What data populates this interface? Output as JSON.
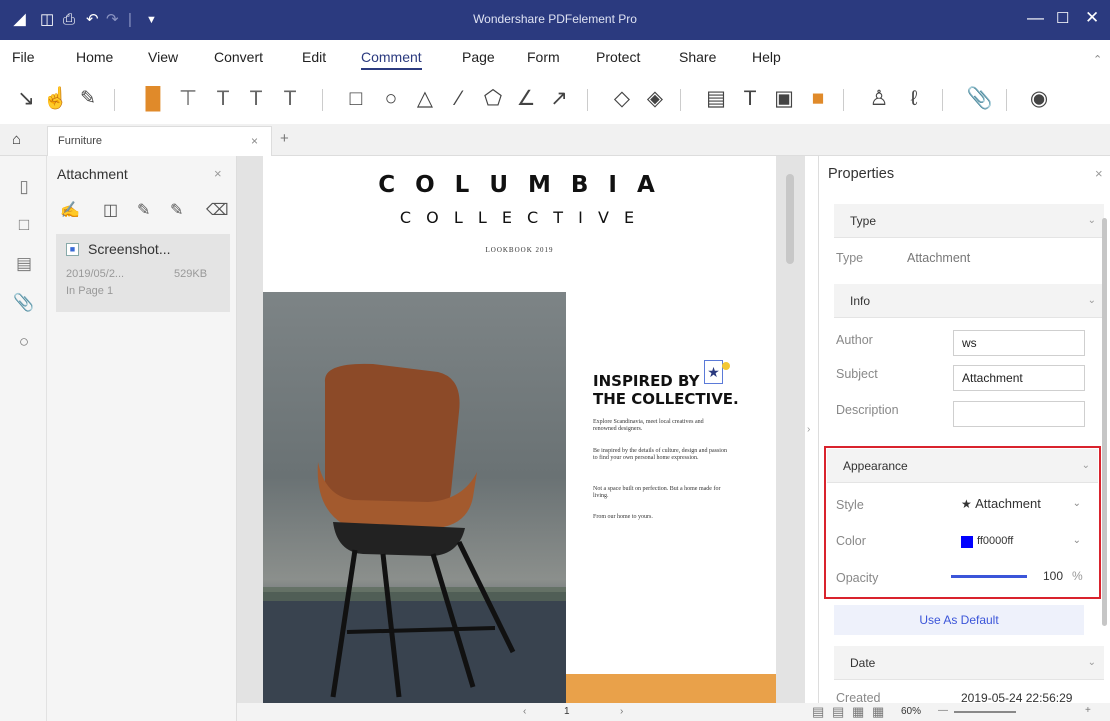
{
  "titlebar": {
    "title": "Wondershare PDFelement Pro",
    "bg": "#2b3a7f"
  },
  "menu": [
    "File",
    "Home",
    "View",
    "Convert",
    "Edit",
    "Comment",
    "Page",
    "Form",
    "Protect",
    "Share",
    "Help"
  ],
  "menu_active": "Comment",
  "tab": {
    "label": "Furniture",
    "close": "×",
    "add": "+"
  },
  "attachment_panel": {
    "title": "Attachment",
    "close": "×",
    "item": {
      "name": "Screenshot...",
      "date": "2019/05/2...",
      "size": "529KB",
      "page": "In Page 1"
    }
  },
  "document": {
    "title": "C O L U M B I A",
    "subtitle": "C O L L E C T I V E",
    "lookbook": "LOOKBOOK 2019",
    "headline_1": "INSPIRED BY",
    "headline_2": "THE COLLECTIVE.",
    "para_1": "Explore Scandinavia, meet local creatives and renowned designers.",
    "para_2": "Be inspired by the details of culture, design and passion to find your own personal home expression.",
    "para_3": "Not a space built on perfection. But a home made for living.",
    "para_4": "From our home to yours."
  },
  "properties": {
    "title": "Properties",
    "close": "×",
    "type_section": "Type",
    "type_label": "Type",
    "type_value": "Attachment",
    "info_section": "Info",
    "author_label": "Author",
    "author_value": "ws",
    "subject_label": "Subject",
    "subject_value": "Attachment",
    "description_label": "Description",
    "description_value": "",
    "appearance_section": "Appearance",
    "style_label": "Style",
    "style_value": "Attachment",
    "color_label": "Color",
    "color_value": "ff0000ff",
    "color_swatch": "#0000ff",
    "opacity_label": "Opacity",
    "opacity_value": "100",
    "opacity_unit": "%",
    "default_button": "Use As Default",
    "date_section": "Date",
    "created_label": "Created",
    "created_value": "2019-05-24 22:56:29"
  },
  "status": {
    "page": "1",
    "zoom": "60%"
  },
  "highlight_color": "#d9232d",
  "accent": "#2b3a7f"
}
